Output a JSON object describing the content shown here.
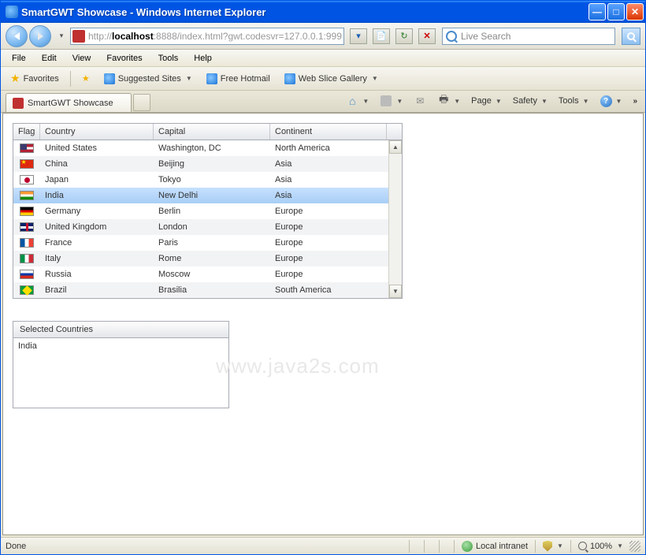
{
  "window": {
    "title": "SmartGWT Showcase - Windows Internet Explorer"
  },
  "nav": {
    "url_prefix": "http://",
    "url_host": "localhost",
    "url_rest": ":8888/index.html?gwt.codesvr=127.0.0.1:999",
    "search_placeholder": "Live Search"
  },
  "menubar": [
    "File",
    "Edit",
    "View",
    "Favorites",
    "Tools",
    "Help"
  ],
  "favbar": {
    "favorites": "Favorites",
    "suggested": "Suggested Sites",
    "hotmail": "Free Hotmail",
    "webslice": "Web Slice Gallery"
  },
  "tab": {
    "title": "SmartGWT Showcase"
  },
  "tabtools": {
    "page": "Page",
    "safety": "Safety",
    "tools": "Tools"
  },
  "grid": {
    "headers": {
      "flag": "Flag",
      "country": "Country",
      "capital": "Capital",
      "continent": "Continent"
    },
    "rows": [
      {
        "flagClass": "flag-us",
        "country": "United States",
        "capital": "Washington, DC",
        "continent": "North America",
        "selected": false
      },
      {
        "flagClass": "flag-cn",
        "country": "China",
        "capital": "Beijing",
        "continent": "Asia",
        "selected": false
      },
      {
        "flagClass": "flag-jp",
        "country": "Japan",
        "capital": "Tokyo",
        "continent": "Asia",
        "selected": false
      },
      {
        "flagClass": "flag-in",
        "country": "India",
        "capital": "New Delhi",
        "continent": "Asia",
        "selected": true
      },
      {
        "flagClass": "flag-de",
        "country": "Germany",
        "capital": "Berlin",
        "continent": "Europe",
        "selected": false
      },
      {
        "flagClass": "flag-uk",
        "country": "United Kingdom",
        "capital": "London",
        "continent": "Europe",
        "selected": false
      },
      {
        "flagClass": "flag-fr",
        "country": "France",
        "capital": "Paris",
        "continent": "Europe",
        "selected": false
      },
      {
        "flagClass": "flag-it",
        "country": "Italy",
        "capital": "Rome",
        "continent": "Europe",
        "selected": false
      },
      {
        "flagClass": "flag-ru",
        "country": "Russia",
        "capital": "Moscow",
        "continent": "Europe",
        "selected": false
      },
      {
        "flagClass": "flag-br",
        "country": "Brazil",
        "capital": "Brasilia",
        "continent": "South America",
        "selected": false
      }
    ]
  },
  "selected": {
    "header": "Selected Countries",
    "body": "India"
  },
  "status": {
    "done": "Done",
    "zone": "Local intranet",
    "zoom": "100%"
  },
  "watermark": "www.java2s.com"
}
